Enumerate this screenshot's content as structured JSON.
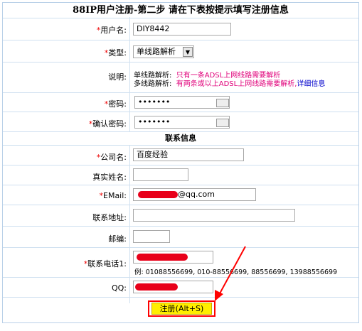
{
  "title": "88IP用户注册-第二步 请在下表按提示填写注册信息",
  "required_mark": "*",
  "fields": {
    "username": {
      "label": "用户名:",
      "value": "DIY8442"
    },
    "type": {
      "label": "类型:",
      "value": "单线路解析"
    },
    "desc": {
      "label": "说明:",
      "line1_prefix": "单线路解析:",
      "line1_text": "只有一条ADSL上网线路需要解析",
      "line2_prefix": "多线路解析:",
      "line2_text": "有两条或以上ADSL上网线路需要解析,",
      "line2_link": "详细信息"
    },
    "password": {
      "label": "密码:",
      "value": "•••••••"
    },
    "confirm": {
      "label": "确认密码:",
      "value": "•••••••"
    },
    "section_contact": "联系信息",
    "company": {
      "label": "公司名:",
      "value": "百度经验"
    },
    "realname": {
      "label": "真实姓名:",
      "value": ""
    },
    "email": {
      "label": "EMail:",
      "value": "@qq.com"
    },
    "address": {
      "label": "联系地址:",
      "value": ""
    },
    "zip": {
      "label": "邮编:",
      "value": ""
    },
    "phone": {
      "label": "联系电话1:",
      "example": "例: 01088556699, 010-88556699, 88556699, 13988556699"
    },
    "qq": {
      "label": "QQ:"
    }
  },
  "submit_label": "注册(Alt+S)",
  "colors": {
    "required": "#e00000",
    "hint": "#e0007a",
    "link": "#0000cc",
    "mask": "#e8001a",
    "arrow": "#ff0000",
    "button_bg": "#ffee00"
  }
}
